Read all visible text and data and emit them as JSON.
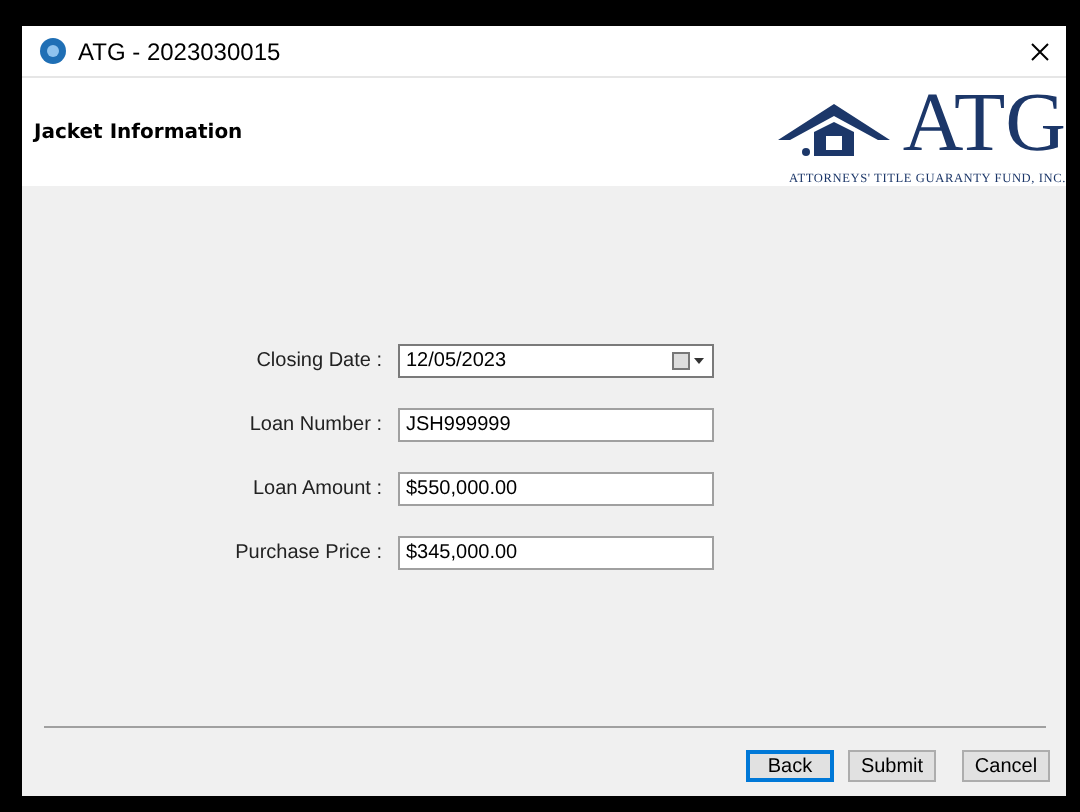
{
  "window": {
    "title": "ATG - 2023030015"
  },
  "header": {
    "title": "Jacket Information",
    "logo_text": "ATG",
    "logo_tagline": "ATTORNEYS' TITLE GUARANTY FUND, INC."
  },
  "fields": [
    {
      "label": "Closing Date :",
      "value": "12/05/2023",
      "kind": "date"
    },
    {
      "label": "Loan Number :",
      "value": "JSH999999",
      "kind": "text"
    },
    {
      "label": "Loan Amount :",
      "value": "$550,000.00",
      "kind": "text"
    },
    {
      "label": "Purchase Price :",
      "value": "$345,000.00",
      "kind": "text"
    }
  ],
  "buttons": [
    {
      "label": "Back",
      "default": true
    },
    {
      "label": "Submit",
      "default": false
    },
    {
      "label": "Cancel",
      "default": false
    }
  ]
}
